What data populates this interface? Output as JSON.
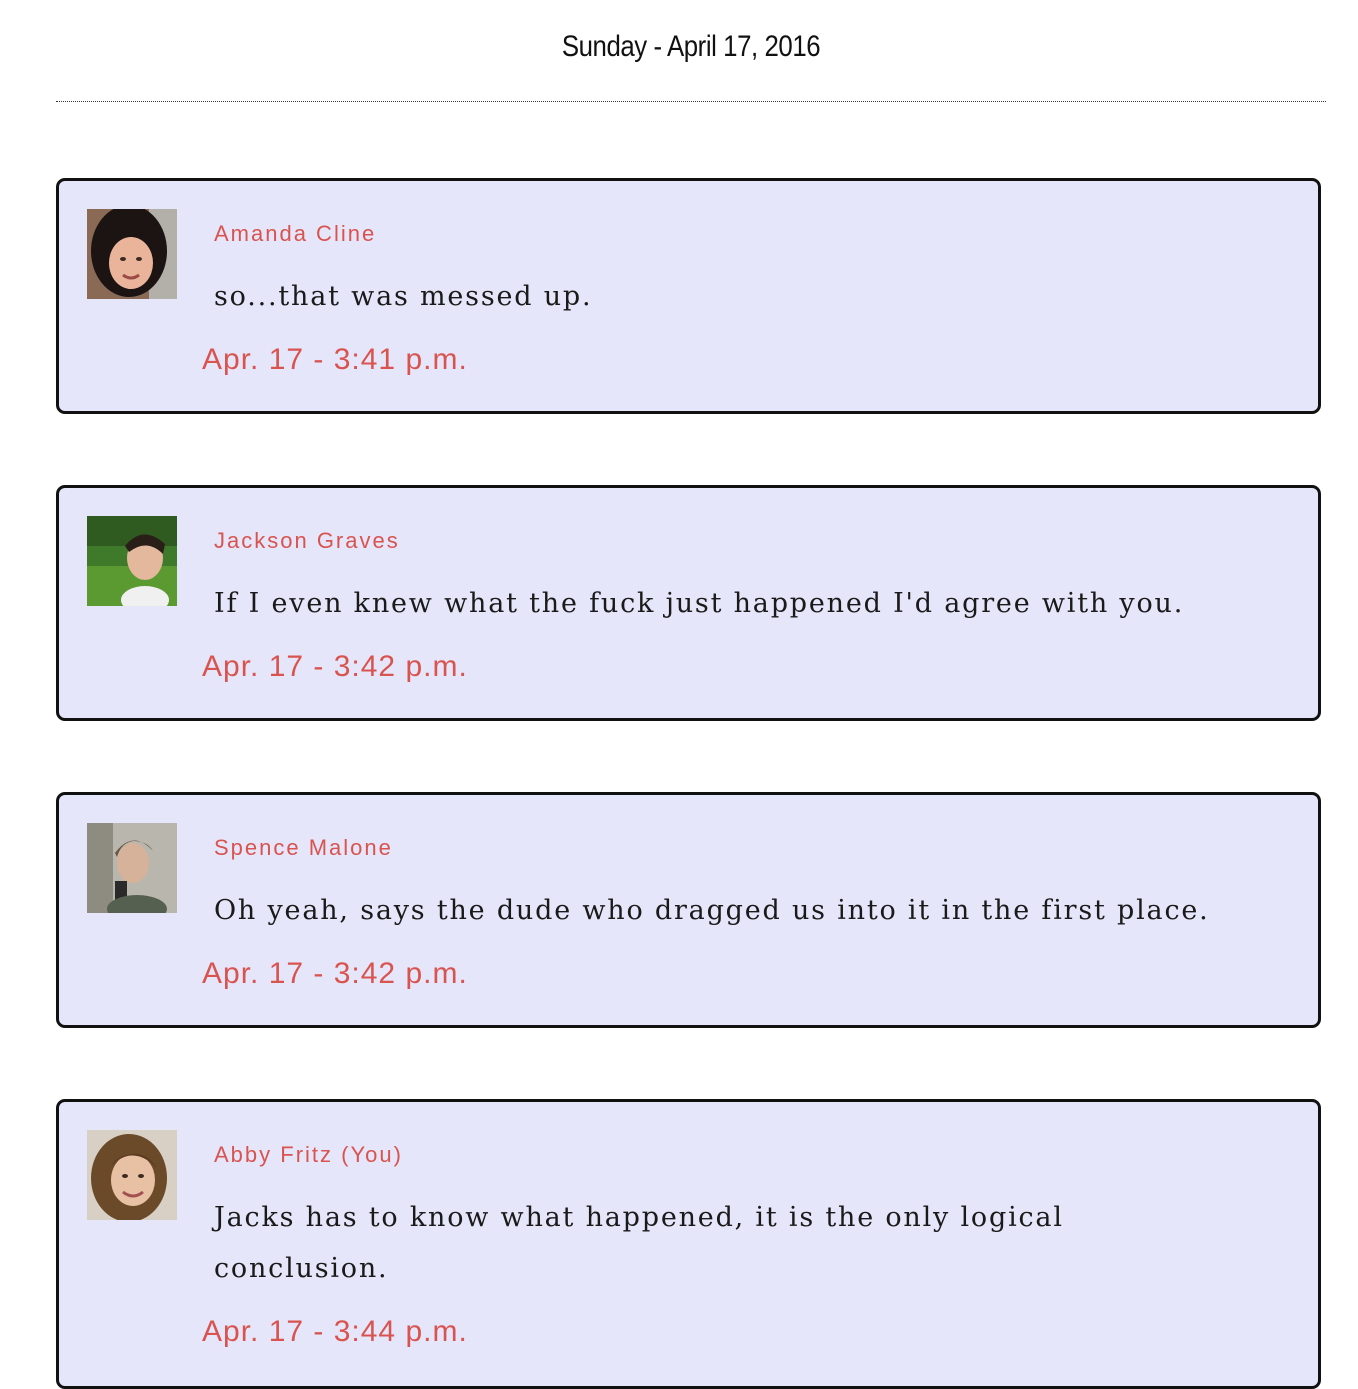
{
  "header": {
    "date": "Sunday - April 17, 2016"
  },
  "colors": {
    "accent": "#d9534f",
    "bubble": "#e6e6fa",
    "border": "#111111"
  },
  "messages": [
    {
      "sender": "Amanda Cline",
      "text": "so...that was messed up.",
      "time": "Apr. 17 - 3:41 p.m."
    },
    {
      "sender": "Jackson Graves",
      "text": "If I even knew what the fuck just happened I'd agree with you.",
      "time": "Apr. 17 - 3:42 p.m."
    },
    {
      "sender": "Spence Malone",
      "text": "Oh yeah, says the dude who dragged us into it in the first place.",
      "time": "Apr. 17 - 3:42 p.m."
    },
    {
      "sender": "Abby Fritz (You)",
      "text": "Jacks has to know what happened, it is the only logical conclusion.",
      "time": "Apr. 17 - 3:44 p.m."
    }
  ]
}
